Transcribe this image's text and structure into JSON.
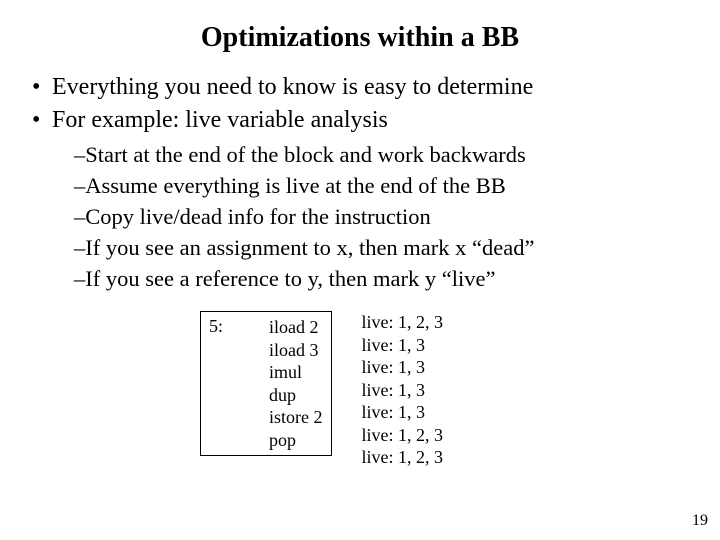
{
  "title": "Optimizations within a BB",
  "bullets": [
    "Everything you need to know is easy to determine",
    "For example:  live variable analysis"
  ],
  "subbullets": [
    "–Start at the end of the block and work backwards",
    "–Assume everything is live at the end of the BB",
    "–Copy live/dead info for the instruction",
    "–If you see an assignment to x, then mark x “dead”",
    "–If you see a reference to y, then mark y “live”"
  ],
  "code": {
    "label": "5:",
    "instrs": [
      "iload 2",
      "iload 3",
      "imul",
      "dup",
      "istore 2",
      "pop"
    ]
  },
  "live": [
    "live: 1, 2, 3",
    "live: 1, 3",
    "live: 1, 3",
    "live: 1, 3",
    "live: 1, 3",
    "live: 1, 2, 3",
    "live: 1, 2, 3"
  ],
  "page": "19"
}
